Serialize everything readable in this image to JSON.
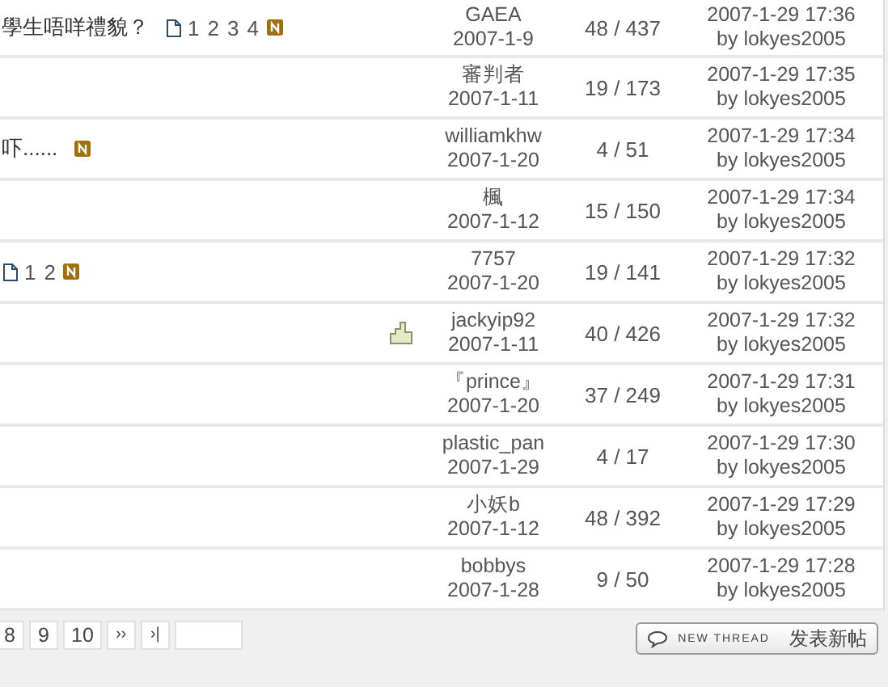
{
  "threads": [
    {
      "title": "學生唔咩禮貌？",
      "pages": [
        "1",
        "2",
        "3",
        "4"
      ],
      "new": true,
      "hot": false,
      "author": "GAEA",
      "date": "2007-1-9",
      "stats": "48 / 437",
      "last_time": "2007-1-29 17:36",
      "last_by": "by lokyes2005"
    },
    {
      "new": false,
      "hot": false,
      "author": "審判者",
      "date": "2007-1-11",
      "stats": "19 / 173",
      "last_time": "2007-1-29 17:35",
      "last_by": "by lokyes2005"
    },
    {
      "title": "吓......",
      "new": true,
      "hot": false,
      "author": "williamkhw",
      "date": "2007-1-20",
      "stats": "4 / 51",
      "last_time": "2007-1-29 17:34",
      "last_by": "by lokyes2005"
    },
    {
      "new": false,
      "hot": false,
      "author": "楓",
      "date": "2007-1-12",
      "stats": "15 / 150",
      "last_time": "2007-1-29 17:34",
      "last_by": "by lokyes2005"
    },
    {
      "pages": [
        "1",
        "2"
      ],
      "new": true,
      "hot": false,
      "author": "7757",
      "date": "2007-1-20",
      "stats": "19 / 141",
      "last_time": "2007-1-29 17:32",
      "last_by": "by lokyes2005"
    },
    {
      "new": false,
      "hot": true,
      "author": "jackyip92",
      "date": "2007-1-11",
      "stats": "40 / 426",
      "last_time": "2007-1-29 17:32",
      "last_by": "by lokyes2005"
    },
    {
      "new": false,
      "hot": false,
      "author": "『prince』",
      "date": "2007-1-20",
      "stats": "37 / 249",
      "last_time": "2007-1-29 17:31",
      "last_by": "by lokyes2005"
    },
    {
      "new": false,
      "hot": false,
      "author": "plastic_pan",
      "date": "2007-1-29",
      "stats": "4 / 17",
      "last_time": "2007-1-29 17:30",
      "last_by": "by lokyes2005"
    },
    {
      "new": false,
      "hot": false,
      "author": "小妖b",
      "date": "2007-1-12",
      "stats": "48 / 392",
      "last_time": "2007-1-29 17:29",
      "last_by": "by lokyes2005"
    },
    {
      "new": false,
      "hot": false,
      "author": "bobbys",
      "date": "2007-1-28",
      "stats": "9 / 50",
      "last_time": "2007-1-29 17:28",
      "last_by": "by lokyes2005"
    }
  ],
  "pager": {
    "pages": [
      "8",
      "9",
      "10"
    ],
    "next": "››",
    "last": "›|"
  },
  "new_thread_button": {
    "caption": "NEW THREAD",
    "label": "发表新帖"
  }
}
